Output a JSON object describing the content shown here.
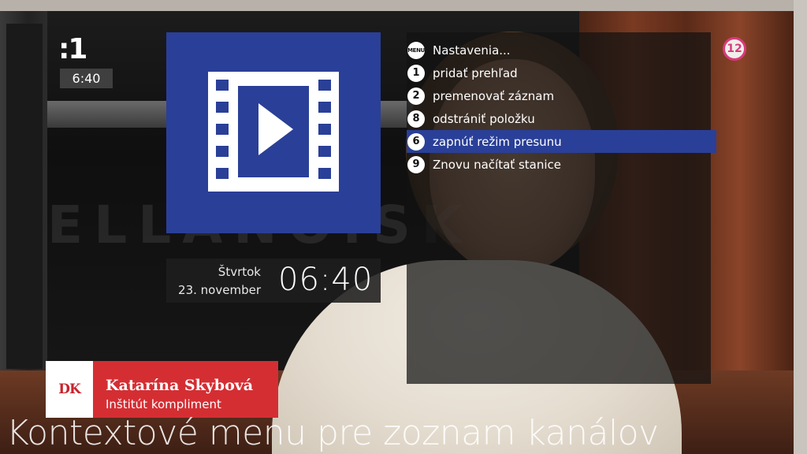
{
  "channel": {
    "logo": ":1",
    "clock": "6:40",
    "age_rating": "12"
  },
  "media_tile": {
    "icon": "film-play-icon",
    "color": "#2a3f97"
  },
  "date_panel": {
    "day": "Štvrtok",
    "date": "23. november",
    "time": "06:40"
  },
  "context_menu": {
    "items": [
      {
        "key": "MENU",
        "label": "Nastavenia..."
      },
      {
        "key": "1",
        "label": "pridať prehľad"
      },
      {
        "key": "2",
        "label": "premenovať záznam"
      },
      {
        "key": "8",
        "label": "odstrániť položku"
      },
      {
        "key": "6",
        "label": "zapnúť režim presunu",
        "selected": true
      },
      {
        "key": "9",
        "label": "Znovu načítať stanice"
      }
    ],
    "selected_color": "#2a3f97"
  },
  "watermark": "ELLANO.SK",
  "lower_third": {
    "logo": "DK",
    "name": "Katarína Skybová",
    "role": "Inštitút kompliment"
  },
  "caption": "Kontextové menu pre zoznam kanálov"
}
